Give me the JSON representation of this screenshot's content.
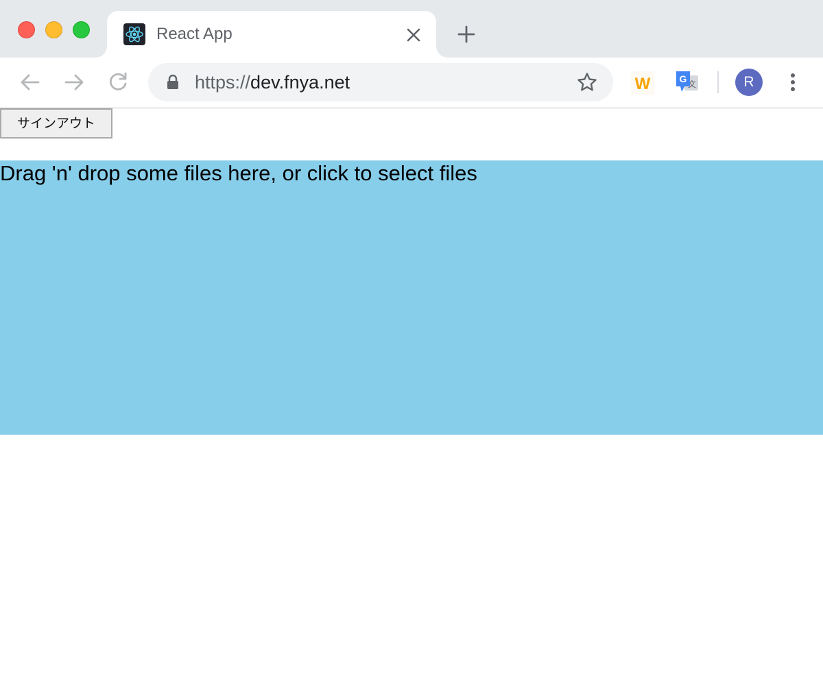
{
  "browser": {
    "tab": {
      "title": "React App",
      "favicon": "react-logo-icon"
    },
    "address_bar": {
      "scheme": "https://",
      "host": "dev.fnya.net"
    },
    "extensions": {
      "w_label": "W",
      "translate_label": "G"
    },
    "profile": {
      "initial": "R"
    },
    "colors": {
      "tabstrip": "#e6e9ec",
      "omnibox": "#f1f3f4",
      "avatar": "#5c6bc0"
    }
  },
  "page": {
    "signout_label": "サインアウト",
    "dropzone": {
      "text": "Drag 'n' drop some files here, or click to select files",
      "background": "#87ceeb"
    }
  }
}
